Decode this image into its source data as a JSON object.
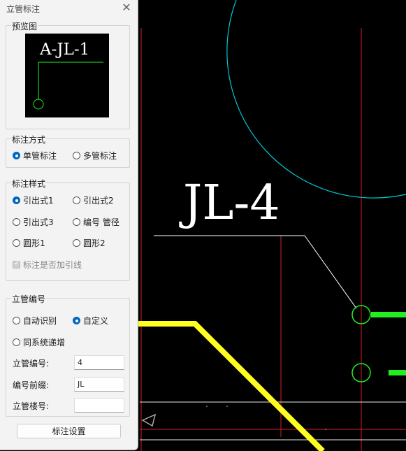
{
  "dialog": {
    "title": "立管标注",
    "preview_label": "预览图",
    "preview_text": "A-JL-1",
    "mode_group": {
      "label": "标注方式",
      "options": [
        "单管标注",
        "多管标注"
      ],
      "selected": "单管标注"
    },
    "style_group": {
      "label": "标注样式",
      "options": [
        "引出式1",
        "引出式2",
        "引出式3",
        "编号 管径",
        "圆形1",
        "圆形2"
      ],
      "selected": "引出式1",
      "leader_checkbox": {
        "label": "标注是否加引线",
        "checked": true,
        "disabled": true
      }
    },
    "number_group": {
      "label": "立管编号",
      "options": [
        "自动识别",
        "自定义",
        "同系统递增"
      ],
      "selected": "自定义",
      "fields": [
        {
          "label": "立管编号:",
          "value": "4"
        },
        {
          "label": "编号前缀:",
          "value": "JL"
        },
        {
          "label": "立管楼号:",
          "value": ""
        }
      ]
    },
    "settings_button": "标注设置"
  },
  "drawing": {
    "annotation_text": "JL-4",
    "colors": {
      "background": "#000000",
      "annotation": "#ffffff",
      "arc": "#00c8d4",
      "axis": "#d42020",
      "pipe_yellow": "#ffff22",
      "pipe_green": "#22ee22"
    }
  }
}
